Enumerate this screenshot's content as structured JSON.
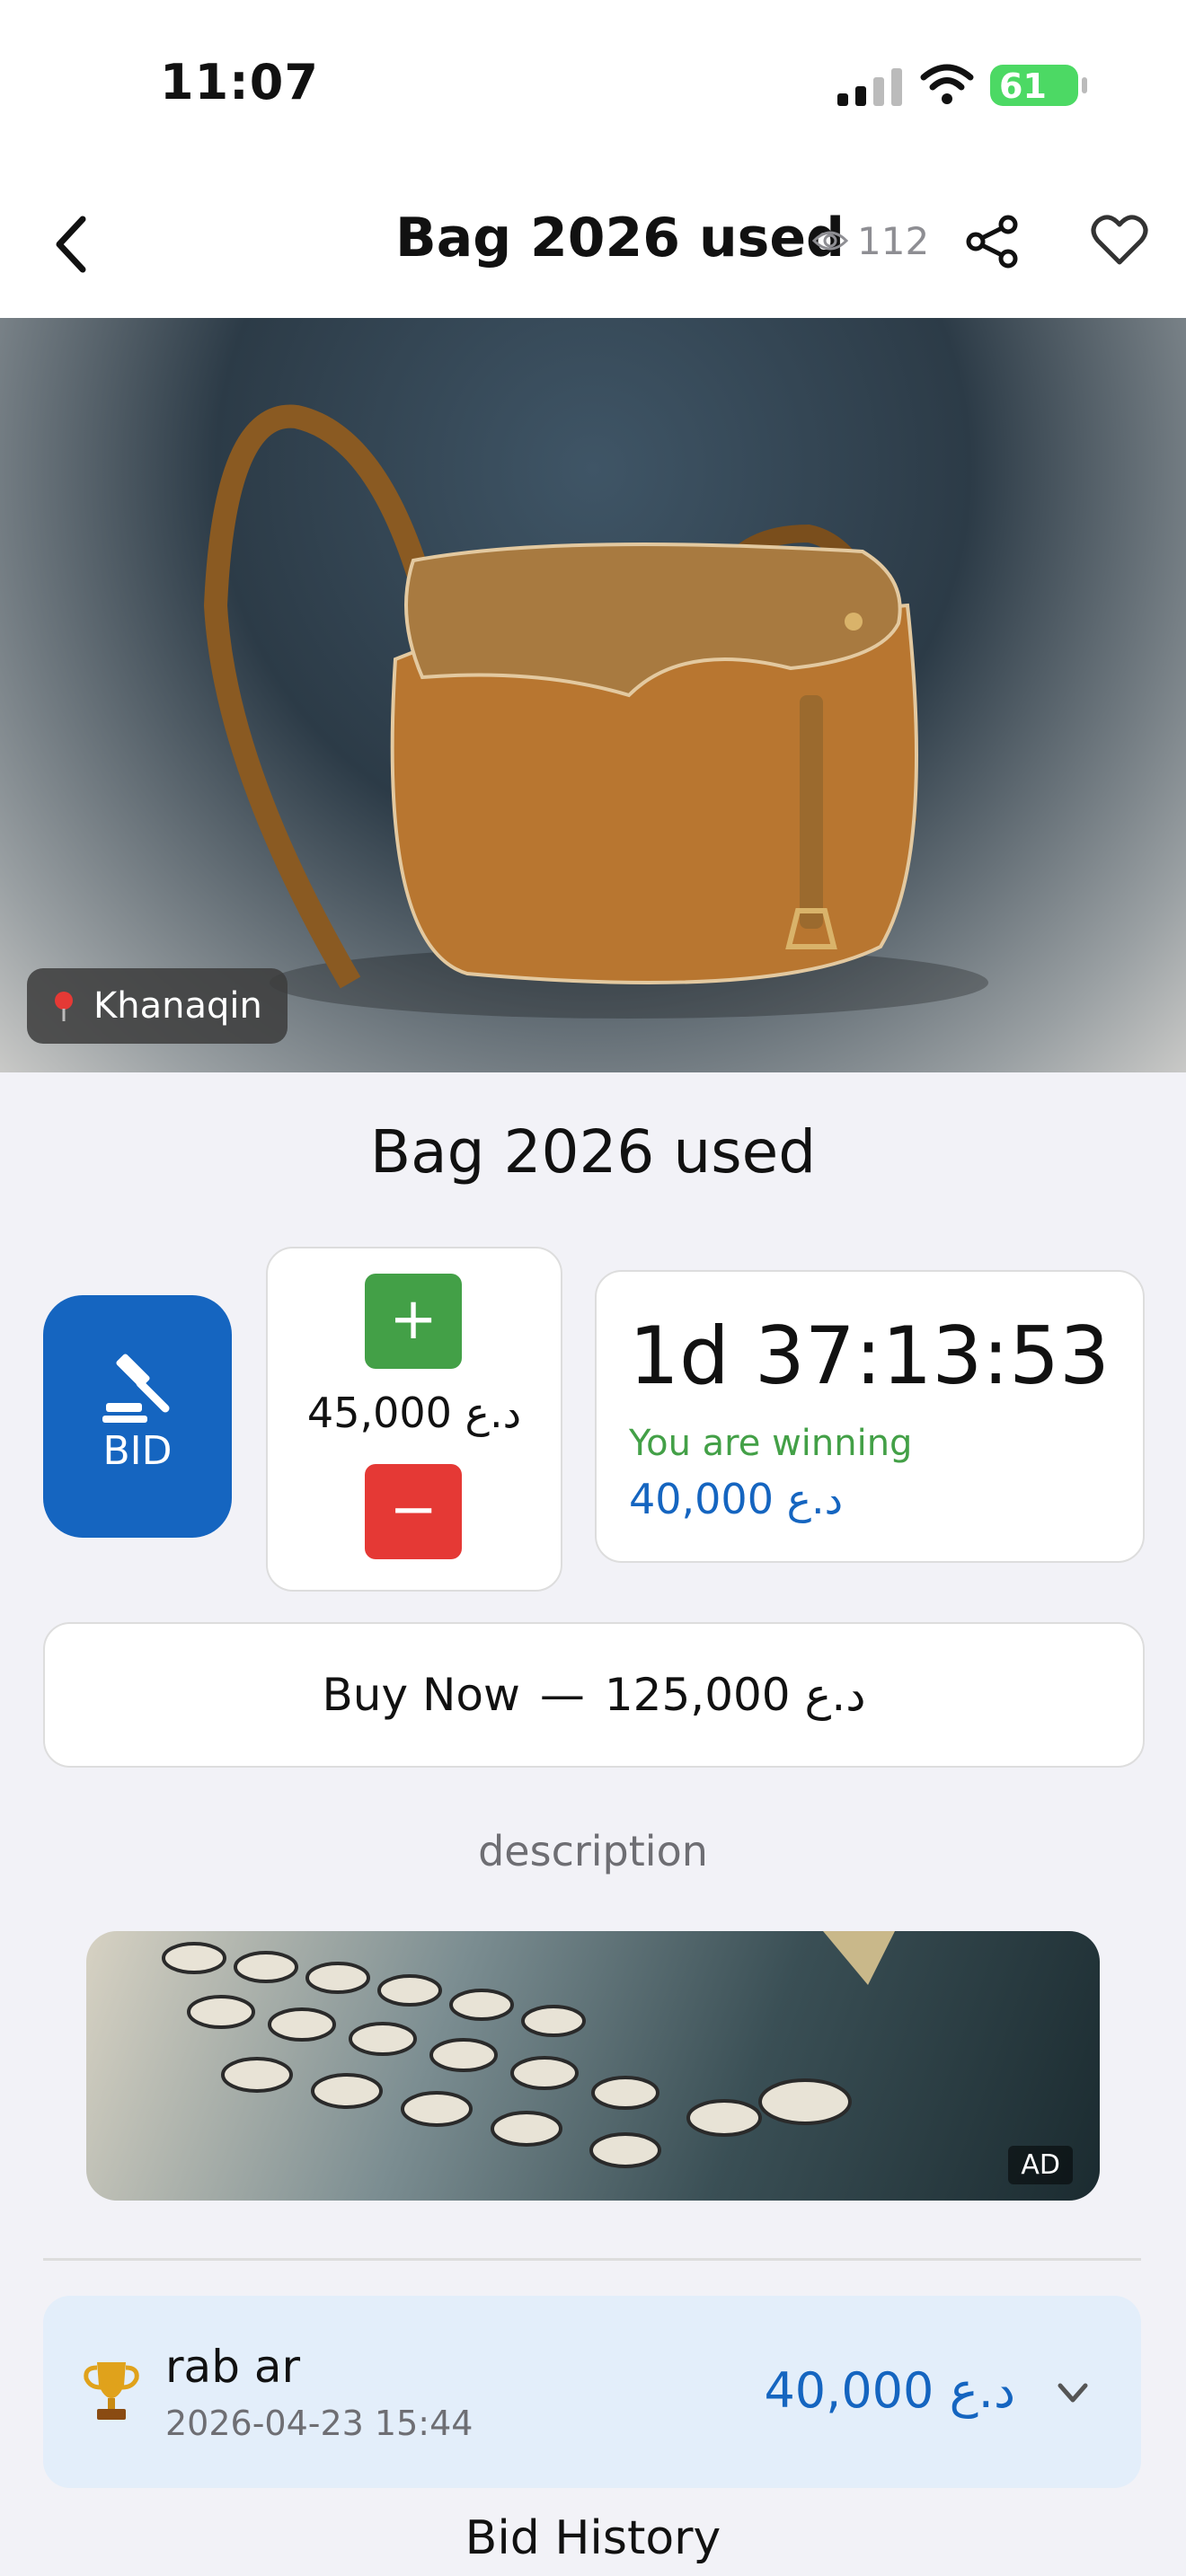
{
  "status_bar": {
    "time": "11:07",
    "battery": "61"
  },
  "nav": {
    "title": "Bag 2026 used",
    "views": "112"
  },
  "hero": {
    "location": "Khanaqin"
  },
  "product": {
    "title": "Bag 2026 used"
  },
  "bid": {
    "button_label": "BID",
    "stepper_value": "45,000 د.ع",
    "plus": "+",
    "minus": "−"
  },
  "timer": {
    "countdown": "1d 37:13:53",
    "status": "You are winning",
    "current_bid": "40,000 د.ع"
  },
  "buy_now": {
    "label": "Buy Now",
    "separator": "—",
    "price": "125,000 د.ع"
  },
  "description": {
    "label": "description"
  },
  "ad": {
    "badge": "AD"
  },
  "top_bid": {
    "bidder": "rab ar",
    "date": "2026-04-23 15:44",
    "amount": "40,000 د.ع"
  },
  "bid_history": {
    "label": "Bid History"
  },
  "colors": {
    "primary": "#1565c0",
    "success": "#43a047",
    "danger": "#e53935"
  },
  "icons": [
    "back-chevron-icon",
    "eye-icon",
    "share-icon",
    "heart-icon",
    "pin-icon",
    "gavel-icon",
    "trophy-icon",
    "chevron-down-icon"
  ]
}
